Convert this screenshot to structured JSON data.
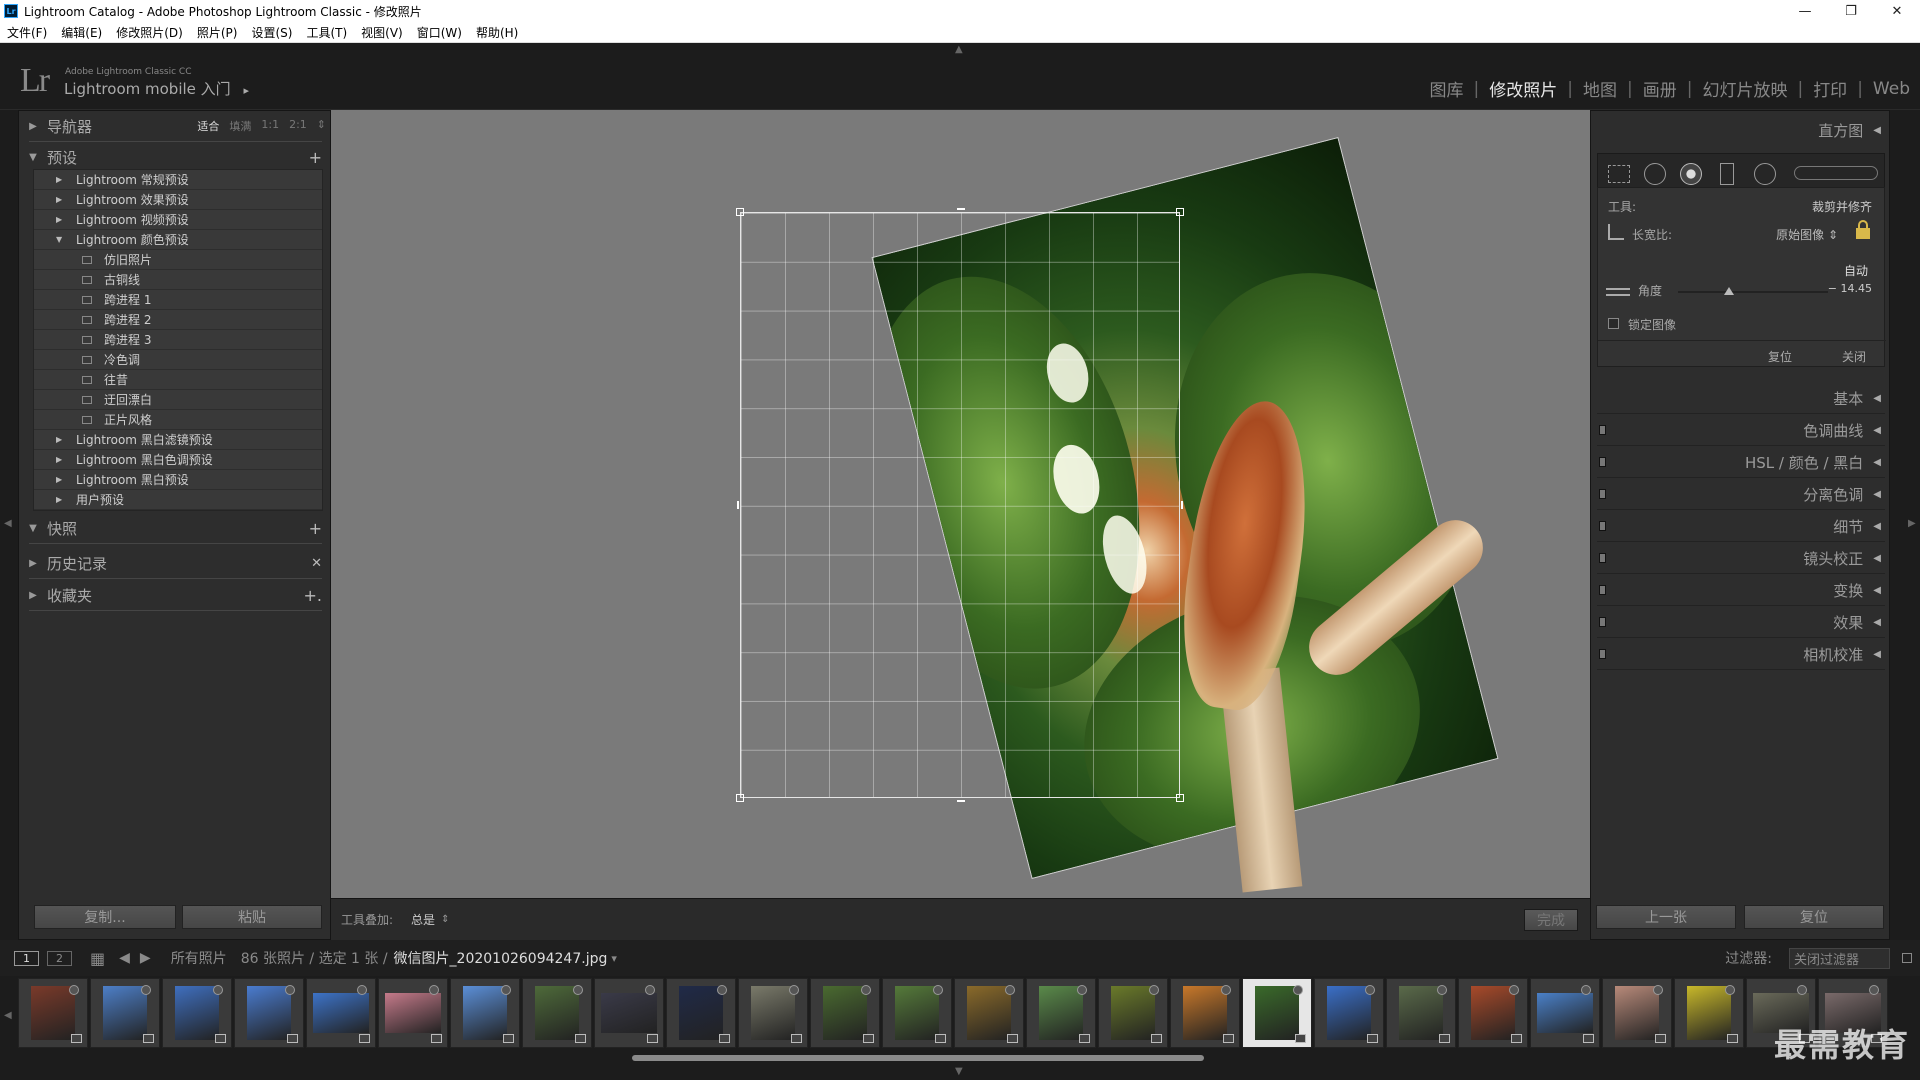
{
  "window": {
    "title": "Lightroom Catalog - Adobe Photoshop Lightroom Classic - 修改照片",
    "app_icon": "Lr",
    "minimize": "—",
    "restore": "❐",
    "close": "✕"
  },
  "menu": [
    "文件(F)",
    "编辑(E)",
    "修改照片(D)",
    "照片(P)",
    "设置(S)",
    "工具(T)",
    "视图(V)",
    "窗口(W)",
    "帮助(H)"
  ],
  "identity": {
    "logo": "Lr",
    "product": "Adobe Lightroom Classic CC",
    "mobile": "Lightroom mobile 入门",
    "mobile_arrow": "▸"
  },
  "modules": {
    "items": [
      "图库",
      "修改照片",
      "地图",
      "画册",
      "幻灯片放映",
      "打印",
      "Web"
    ],
    "active": "修改照片",
    "separator": "|"
  },
  "left": {
    "navigator": {
      "label": "导航器",
      "opts": [
        "适合",
        "填满",
        "1:1",
        "2:1"
      ],
      "opts_arrow": "⇕"
    },
    "presets": {
      "label": "预设",
      "add": "+",
      "items": [
        {
          "label": "Lightroom 常规预设",
          "type": "folder",
          "open": false
        },
        {
          "label": "Lightroom 效果预设",
          "type": "folder",
          "open": false
        },
        {
          "label": "Lightroom 视频预设",
          "type": "folder",
          "open": false
        },
        {
          "label": "Lightroom 颜色预设",
          "type": "folder",
          "open": true
        },
        {
          "label": "仿旧照片",
          "type": "preset"
        },
        {
          "label": "古铜线",
          "type": "preset"
        },
        {
          "label": "跨进程 1",
          "type": "preset"
        },
        {
          "label": "跨进程 2",
          "type": "preset"
        },
        {
          "label": "跨进程 3",
          "type": "preset"
        },
        {
          "label": "冷色调",
          "type": "preset"
        },
        {
          "label": "往昔",
          "type": "preset"
        },
        {
          "label": "迂回漂白",
          "type": "preset"
        },
        {
          "label": "正片风格",
          "type": "preset"
        },
        {
          "label": "Lightroom 黑白滤镜预设",
          "type": "folder",
          "open": false
        },
        {
          "label": "Lightroom 黑白色调预设",
          "type": "folder",
          "open": false
        },
        {
          "label": "Lightroom 黑白预设",
          "type": "folder",
          "open": false
        },
        {
          "label": "用户预设",
          "type": "folder",
          "open": false
        }
      ]
    },
    "snapshots": {
      "label": "快照",
      "action": "+"
    },
    "history": {
      "label": "历史记录",
      "action": "✕"
    },
    "collections": {
      "label": "收藏夹",
      "action": "+."
    },
    "copy": "复制...",
    "paste": "粘贴"
  },
  "center": {
    "overlay_label": "工具叠加:",
    "overlay_value": "总是",
    "overlay_arrow": "⇕",
    "done": "完成"
  },
  "right": {
    "histogram": "直方图",
    "tool_label": "工具:",
    "tool_value": "裁剪并修齐",
    "aspect_label": "长宽比:",
    "aspect_value": "原始图像 ⇕",
    "auto": "自动",
    "angle_label": "角度",
    "angle_value": "− 14.45",
    "angle": -14.45,
    "angle_range": [
      -45,
      45
    ],
    "constrain": "锁定图像",
    "constrain_checked": false,
    "reset": "复位",
    "close": "关闭",
    "panels": [
      {
        "label": "基本",
        "switch": false
      },
      {
        "label": "色调曲线",
        "switch": true
      },
      {
        "label": "HSL / 颜色 / 黑白",
        "switch": true
      },
      {
        "label": "分离色调",
        "switch": true
      },
      {
        "label": "细节",
        "switch": true
      },
      {
        "label": "镜头校正",
        "switch": true
      },
      {
        "label": "变换",
        "switch": true
      },
      {
        "label": "效果",
        "switch": true
      },
      {
        "label": "相机校准",
        "switch": true
      }
    ],
    "prev": "上一张",
    "reset_all": "复位"
  },
  "filmstrip": {
    "screen1": "1",
    "screen2": "2",
    "source": "所有照片",
    "info": "86 张照片 / 选定 1 张 /",
    "filename": "微信图片_20201026094247.jpg",
    "filename_arrow": "▾",
    "filter_label": "过滤器:",
    "filter_value": "关闭过滤器",
    "thumbs": [
      {
        "color": "#7a3a2a",
        "wide": false
      },
      {
        "color": "#4d7fc8",
        "wide": false
      },
      {
        "color": "#3f6fbf",
        "wide": false
      },
      {
        "color": "#4a7cd0",
        "wide": false
      },
      {
        "color": "#3d73c8",
        "wide": true
      },
      {
        "color": "#c57a8a",
        "wide": true
      },
      {
        "color": "#5b8fd8",
        "wide": false
      },
      {
        "color": "#4e6a3a",
        "wide": false
      },
      {
        "color": "#3a3a48",
        "wide": true
      },
      {
        "color": "#202a48",
        "wide": false
      },
      {
        "color": "#7a7a6a",
        "wide": false
      },
      {
        "color": "#4a6a30",
        "wide": false
      },
      {
        "color": "#557a3a",
        "wide": false
      },
      {
        "color": "#8a6a2a",
        "wide": false
      },
      {
        "color": "#5a8a4a",
        "wide": false
      },
      {
        "color": "#6a7a2a",
        "wide": false
      },
      {
        "color": "#c8782a",
        "wide": false
      },
      {
        "color": "#3a6a2a",
        "wide": false,
        "selected": true
      },
      {
        "color": "#3a6fc8",
        "wide": false
      },
      {
        "color": "#5a6a4a",
        "wide": false
      },
      {
        "color": "#a84a2a",
        "wide": false
      },
      {
        "color": "#4a80c8",
        "wide": true
      },
      {
        "color": "#b88a7a",
        "wide": false
      },
      {
        "color": "#c8b82a",
        "wide": false
      },
      {
        "color": "#6a6a5a",
        "wide": true
      },
      {
        "color": "#7a6a6a",
        "wide": true
      }
    ]
  },
  "watermark": "最需教育"
}
